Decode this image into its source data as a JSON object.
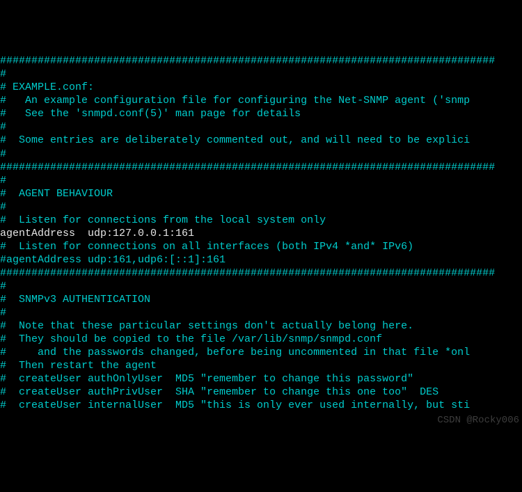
{
  "lines": [
    {
      "cls": "cyan",
      "text": "###############################################################################"
    },
    {
      "cls": "cyan",
      "text": "#"
    },
    {
      "cls": "cyan",
      "text": "# EXAMPLE.conf:"
    },
    {
      "cls": "cyan",
      "text": "#   An example configuration file for configuring the Net-SNMP agent ('snmp"
    },
    {
      "cls": "cyan",
      "text": "#   See the 'snmpd.conf(5)' man page for details"
    },
    {
      "cls": "cyan",
      "text": "#"
    },
    {
      "cls": "cyan",
      "text": "#  Some entries are deliberately commented out, and will need to be explici"
    },
    {
      "cls": "cyan",
      "text": "#"
    },
    {
      "cls": "cyan",
      "text": "###############################################################################"
    },
    {
      "cls": "cyan",
      "text": "#"
    },
    {
      "cls": "cyan",
      "text": "#  AGENT BEHAVIOUR"
    },
    {
      "cls": "cyan",
      "text": "#"
    },
    {
      "cls": "cyan",
      "text": ""
    },
    {
      "cls": "cyan",
      "text": "#  Listen for connections from the local system only"
    },
    {
      "cls": "white",
      "text": "agentAddress  udp:127.0.0.1:161"
    },
    {
      "cls": "cyan",
      "text": "#  Listen for connections on all interfaces (both IPv4 *and* IPv6)"
    },
    {
      "cls": "cyan",
      "text": "#agentAddress udp:161,udp6:[::1]:161"
    },
    {
      "cls": "cyan",
      "text": ""
    },
    {
      "cls": "cyan",
      "text": ""
    },
    {
      "cls": "cyan",
      "text": ""
    },
    {
      "cls": "cyan",
      "text": "###############################################################################"
    },
    {
      "cls": "cyan",
      "text": "#"
    },
    {
      "cls": "cyan",
      "text": "#  SNMPv3 AUTHENTICATION"
    },
    {
      "cls": "cyan",
      "text": "#"
    },
    {
      "cls": "cyan",
      "text": "#  Note that these particular settings don't actually belong here."
    },
    {
      "cls": "cyan",
      "text": "#  They should be copied to the file /var/lib/snmp/snmpd.conf"
    },
    {
      "cls": "cyan",
      "text": "#     and the passwords changed, before being uncommented in that file *onl"
    },
    {
      "cls": "cyan",
      "text": "#  Then restart the agent"
    },
    {
      "cls": "cyan",
      "text": ""
    },
    {
      "cls": "cyan",
      "text": "#  createUser authOnlyUser  MD5 \"remember to change this password\""
    },
    {
      "cls": "cyan",
      "text": "#  createUser authPrivUser  SHA \"remember to change this one too\"  DES"
    },
    {
      "cls": "cyan",
      "text": "#  createUser internalUser  MD5 \"this is only ever used internally, but sti"
    }
  ],
  "watermark": "CSDN @Rocky006"
}
